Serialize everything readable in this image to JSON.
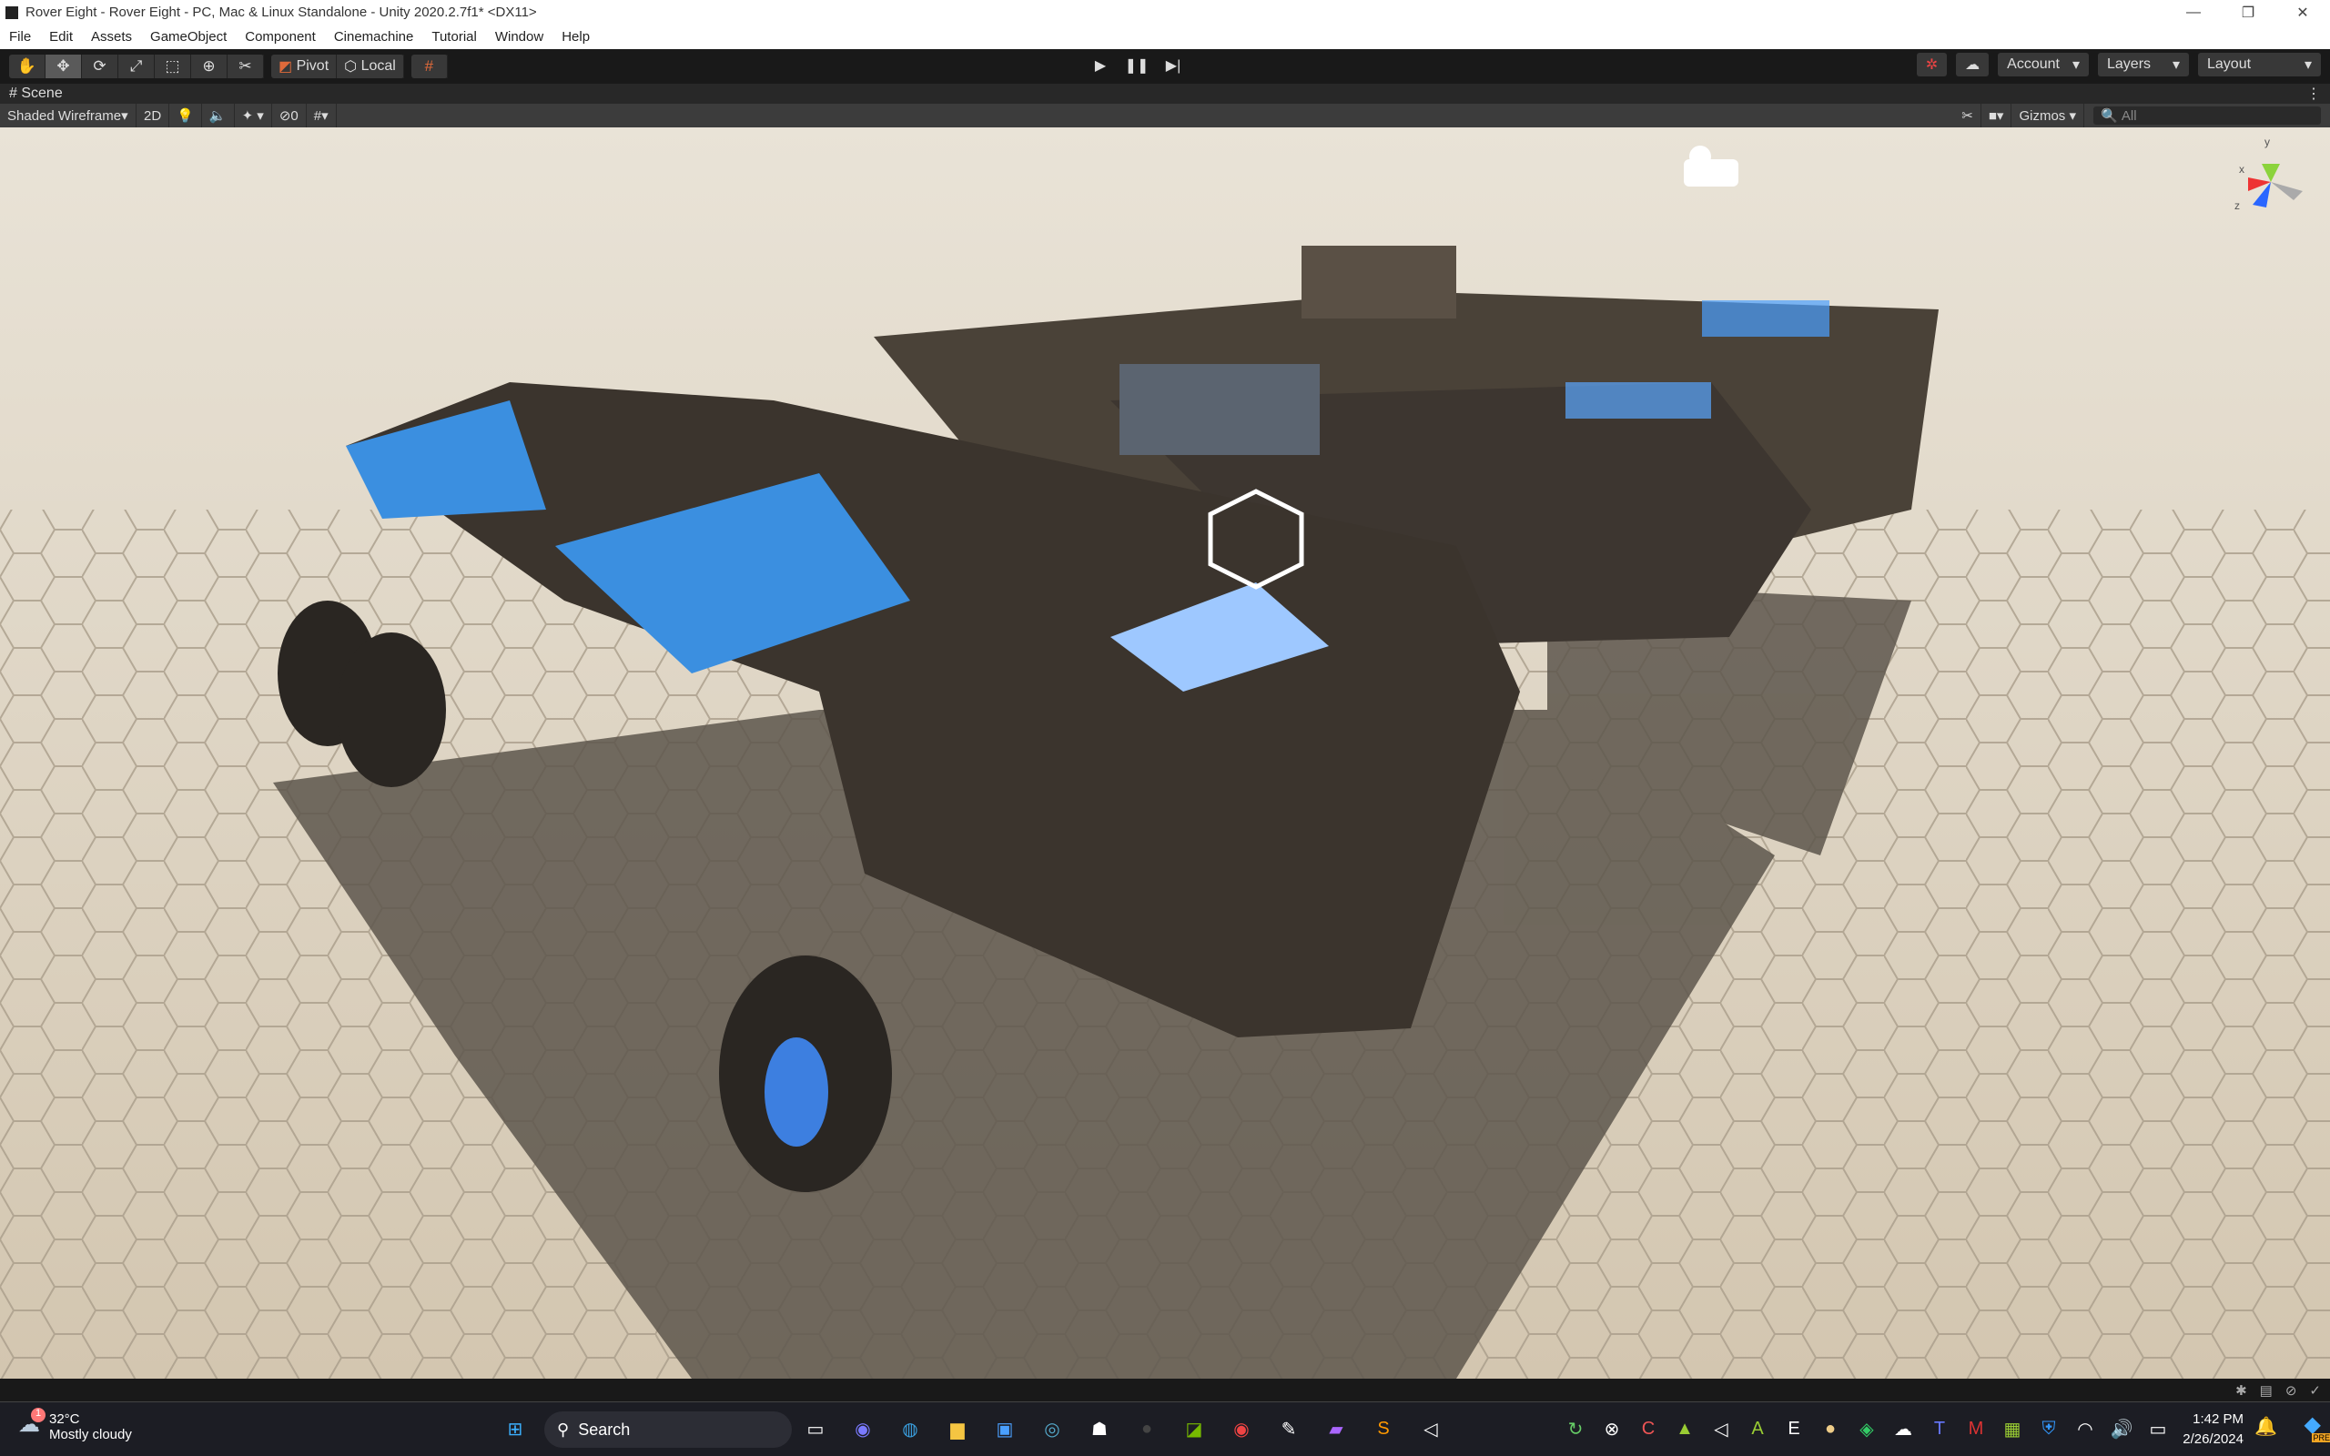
{
  "window": {
    "title": "Rover Eight - Rover Eight - PC, Mac & Linux Standalone - Unity 2020.2.7f1* <DX11>"
  },
  "menu": [
    "File",
    "Edit",
    "Assets",
    "GameObject",
    "Component",
    "Cinemachine",
    "Tutorial",
    "Window",
    "Help"
  ],
  "toolbar": {
    "pivot": "Pivot",
    "local": "Local",
    "account": "Account",
    "layers": "Layers",
    "layout": "Layout"
  },
  "scene": {
    "tab": "Scene",
    "shading": "Shaded Wireframe",
    "mode2d": "2D",
    "hidden_count": "0",
    "gizmos": "Gizmos",
    "search_placeholder": "All",
    "axis_x": "x",
    "axis_y": "y",
    "axis_z": "z"
  },
  "taskbar": {
    "temp": "32°C",
    "weather": "Mostly cloudy",
    "weather_badge": "1",
    "search": "Search",
    "time": "1:42 PM",
    "date": "2/26/2024",
    "copilot_badge": "PRE"
  },
  "colors": {
    "accent": "#3aa0ff",
    "ground": "#d9cfbd"
  }
}
